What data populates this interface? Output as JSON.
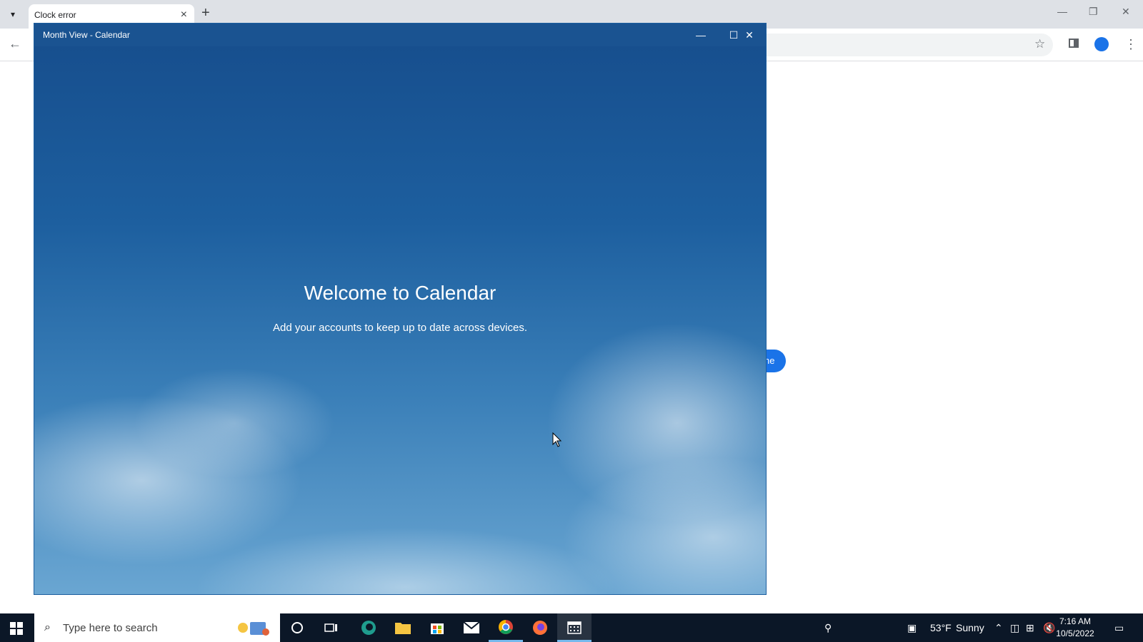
{
  "browser": {
    "tab_title": "Clock error",
    "page_button_label": "ne"
  },
  "calendar_window": {
    "title": "Month View - Calendar",
    "heading": "Welcome to Calendar",
    "subtitle": "Add your accounts to keep up to date across devices."
  },
  "taskbar": {
    "search_placeholder": "Type here to search",
    "weather_temp": "53°F",
    "weather_desc": "Sunny",
    "time": "7:16 AM",
    "date": "10/5/2022"
  },
  "icons": {
    "tab_search": "chevron-down-icon",
    "tab_close": "close-icon",
    "new_tab": "plus-icon",
    "back": "arrow-left-icon",
    "bookmark": "star-icon",
    "side_panel": "side-panel-icon",
    "profile": "profile-icon",
    "menu": "kebab-menu-icon"
  },
  "colors": {
    "chrome_tabbar": "#dee1e6",
    "calendar_titlebar": "#1a5391",
    "accent_button": "#1a73e8",
    "taskbar": "#0b1727"
  }
}
